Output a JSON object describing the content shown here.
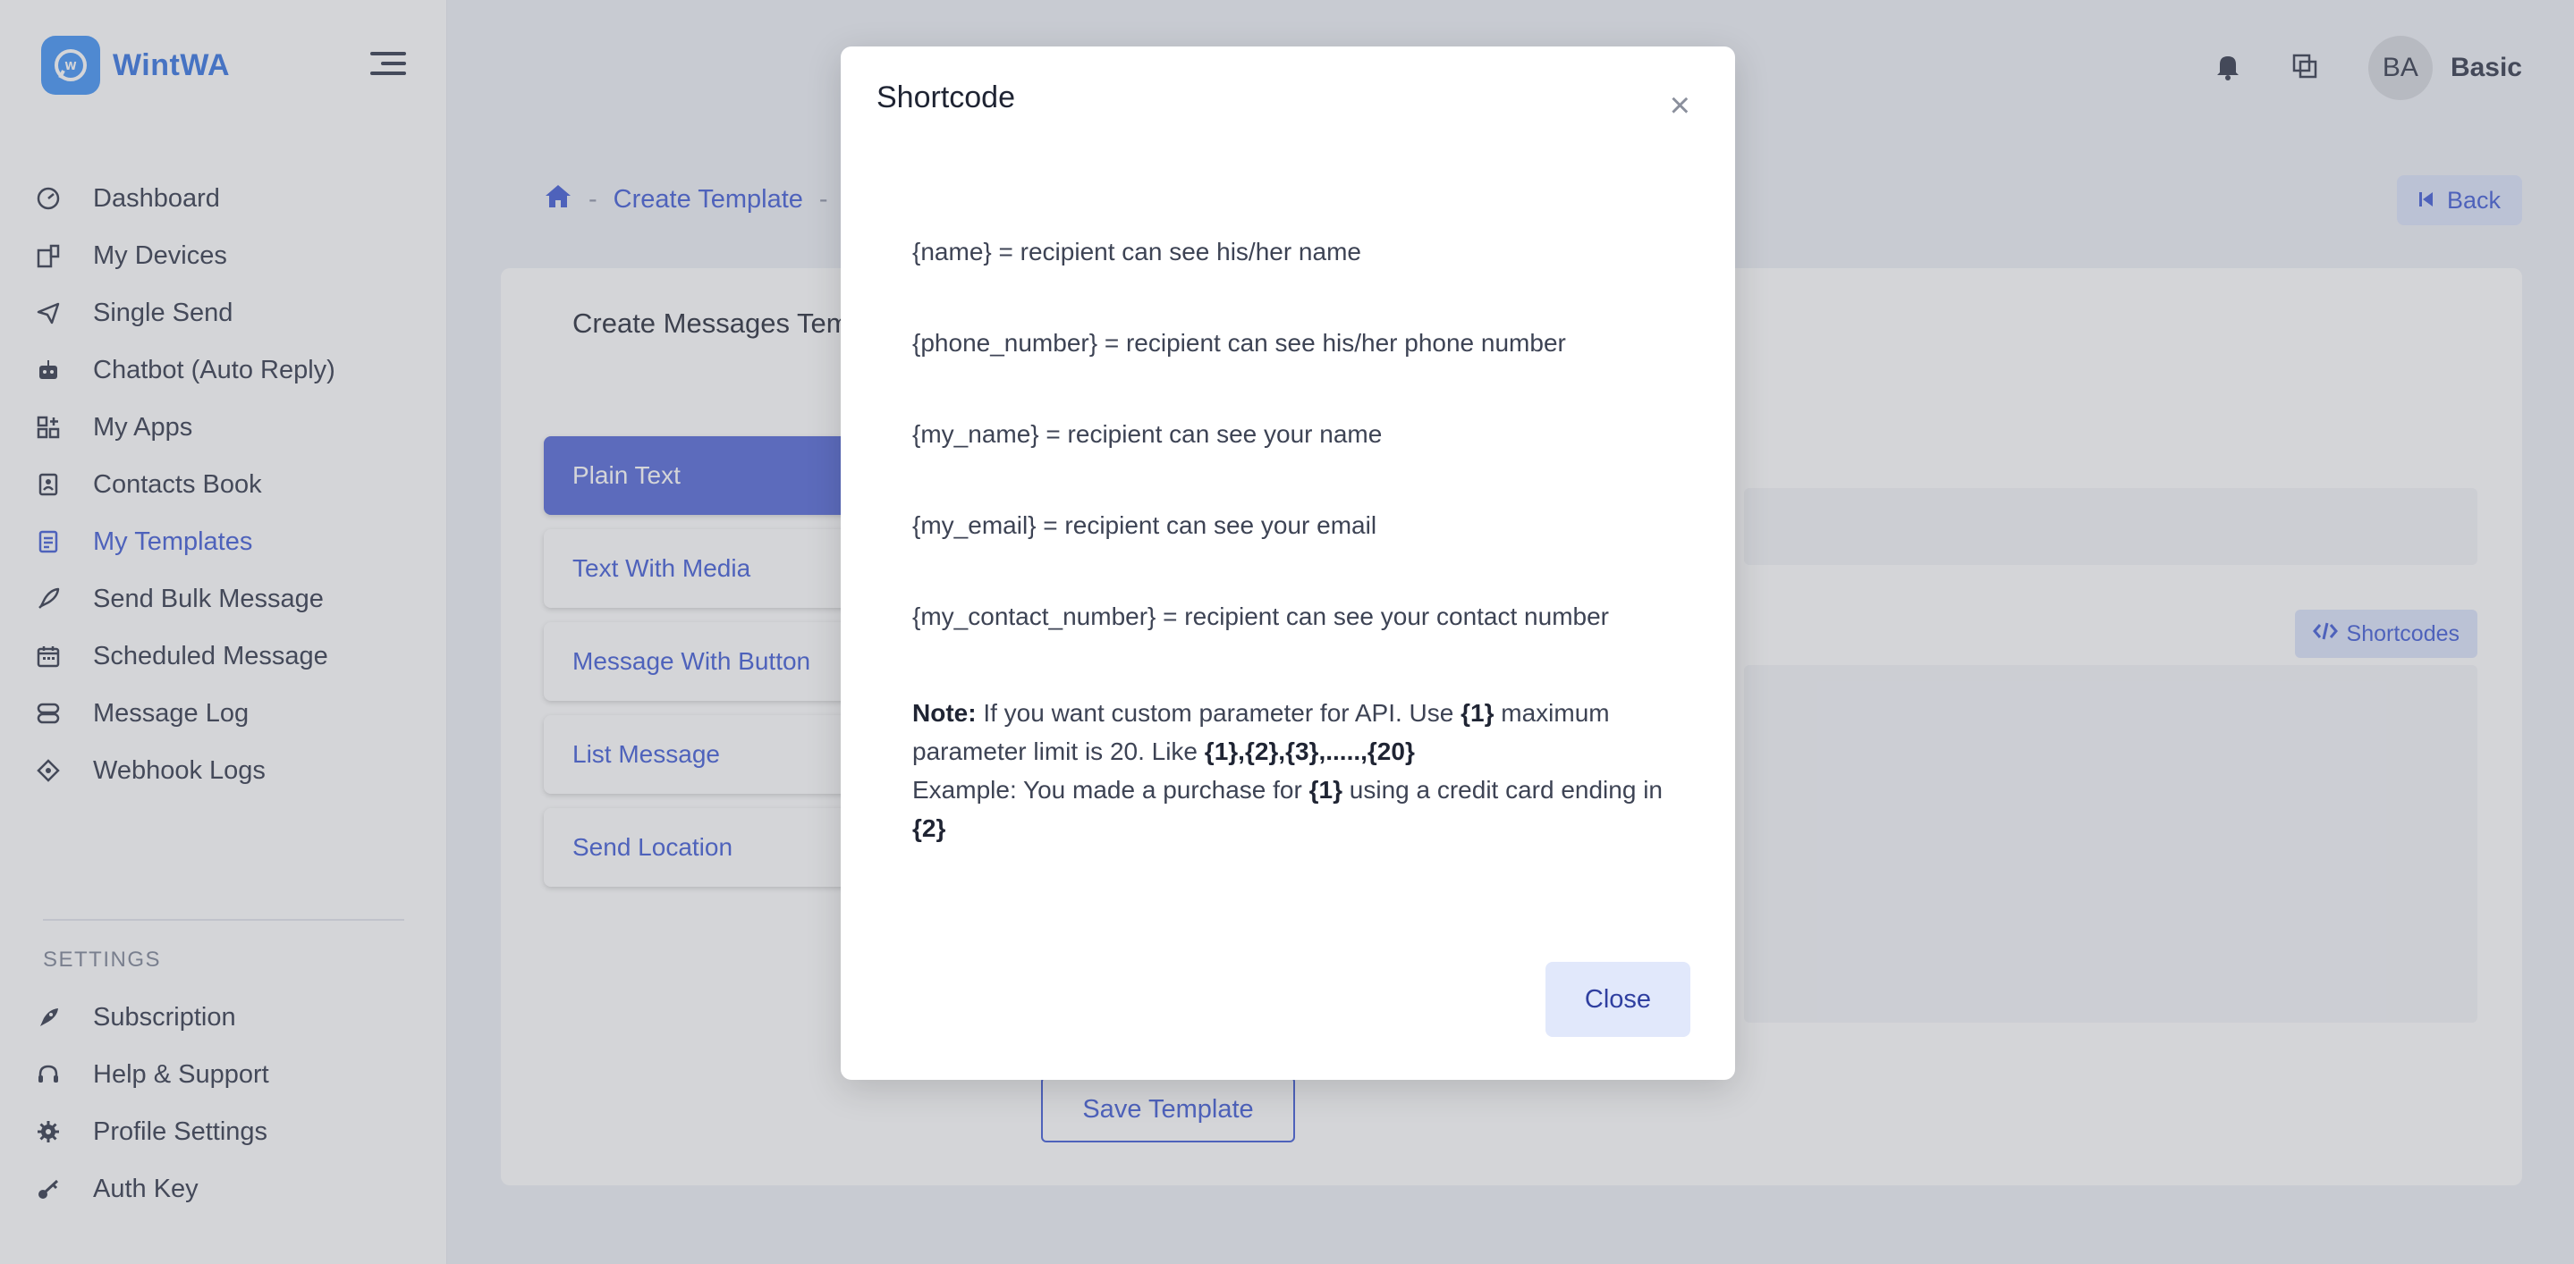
{
  "brand": {
    "name": "WintWA"
  },
  "sidebar": {
    "items": [
      {
        "label": "Dashboard",
        "icon": "dashboard-icon"
      },
      {
        "label": "My Devices",
        "icon": "devices-icon"
      },
      {
        "label": "Single Send",
        "icon": "send-icon"
      },
      {
        "label": "Chatbot (Auto Reply)",
        "icon": "robot-icon"
      },
      {
        "label": "My Apps",
        "icon": "apps-icon"
      },
      {
        "label": "Contacts Book",
        "icon": "contacts-icon"
      },
      {
        "label": "My Templates",
        "icon": "templates-icon"
      },
      {
        "label": "Send Bulk Message",
        "icon": "rocket-icon"
      },
      {
        "label": "Scheduled Message",
        "icon": "calendar-icon"
      },
      {
        "label": "Message Log",
        "icon": "log-icon"
      },
      {
        "label": "Webhook Logs",
        "icon": "webhook-icon"
      }
    ],
    "settings_title": "SETTINGS",
    "settings_items": [
      {
        "label": "Subscription",
        "icon": "subscription-icon"
      },
      {
        "label": "Help & Support",
        "icon": "headset-icon"
      },
      {
        "label": "Profile Settings",
        "icon": "gear-icon"
      },
      {
        "label": "Auth Key",
        "icon": "key-icon"
      }
    ]
  },
  "topbar": {
    "avatar_initials": "BA",
    "user_name": "Basic"
  },
  "breadcrumb": {
    "current": "Create Template"
  },
  "back_label": "Back",
  "card": {
    "title": "Create Messages Template",
    "tabs": [
      "Plain Text",
      "Text With Media",
      "Message With Button",
      "List Message",
      "Send Location"
    ],
    "shortcodes_label": "Shortcodes",
    "save_label": "Save Template"
  },
  "modal": {
    "title": "Shortcode",
    "close_x": "×",
    "lines": [
      "{name} = recipient can see his/her name",
      "{phone_number} = recipient can see his/her phone number",
      "{my_name} = recipient can see your name",
      "{my_email} = recipient can see your email",
      "{my_contact_number} = recipient can see your contact number"
    ],
    "note": {
      "label": "Note:",
      "text1": " If you want custom parameter for API. Use ",
      "code1": "{1}",
      "text2": " maximum parameter limit is 20. Like ",
      "code2": "{1},{2},{3},.....,{20}",
      "example_prefix": "Example: You made a purchase for ",
      "example_code1": "{1}",
      "example_mid": " using a credit card ending in ",
      "example_code2": "{2}"
    },
    "close_label": "Close"
  },
  "colors": {
    "accent": "#3a56d4",
    "active_tab": "#4e63d6",
    "brand": "#3b8ff5"
  }
}
